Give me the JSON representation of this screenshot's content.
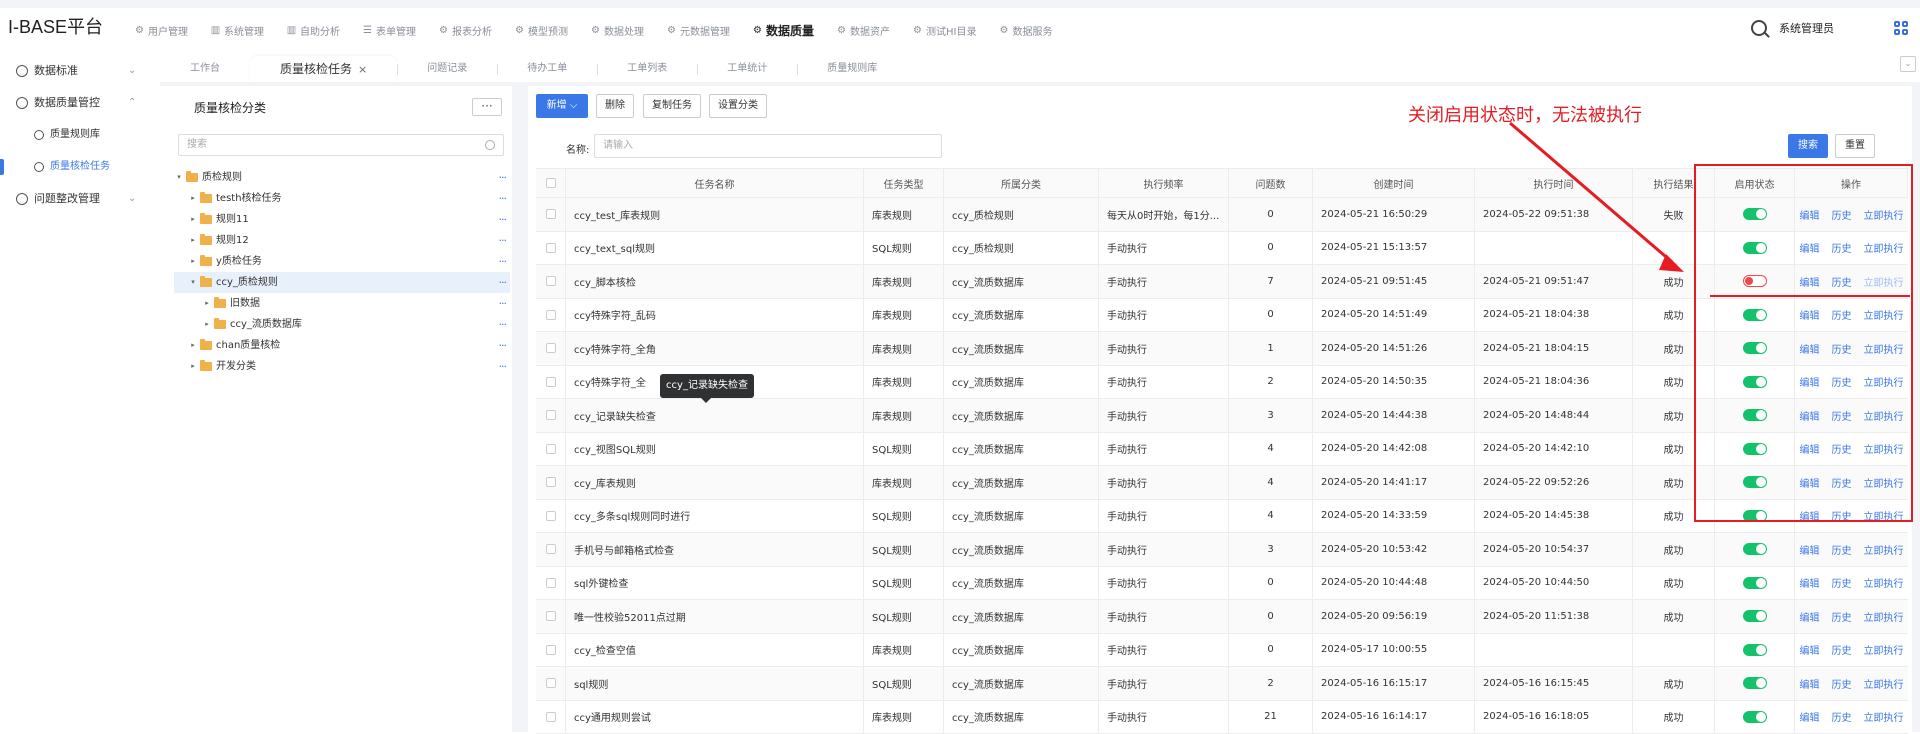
{
  "app": {
    "title": "I-BASE平台",
    "user": "系统管理员"
  },
  "topnav": [
    {
      "label": "用户管理",
      "icon": "gear-icon",
      "glyph": "⚙"
    },
    {
      "label": "系统管理",
      "icon": "bar-chart-icon",
      "glyph": "▥"
    },
    {
      "label": "自助分析",
      "icon": "bar-chart-icon",
      "glyph": "▥"
    },
    {
      "label": "表单管理",
      "icon": "list-icon",
      "glyph": "☰"
    },
    {
      "label": "报表分析",
      "icon": "gear-icon",
      "glyph": "⚙"
    },
    {
      "label": "模型预测",
      "icon": "gear-icon",
      "glyph": "⚙"
    },
    {
      "label": "数据处理",
      "icon": "gear-icon",
      "glyph": "⚙"
    },
    {
      "label": "元数据管理",
      "icon": "gear-icon",
      "glyph": "⚙"
    },
    {
      "label": "数据质量",
      "icon": "gear-icon",
      "glyph": "⚙",
      "active": true
    },
    {
      "label": "数据资产",
      "icon": "gear-icon",
      "glyph": "⚙"
    },
    {
      "label": "测试HI目录",
      "icon": "gear-icon",
      "glyph": "⚙"
    },
    {
      "label": "数据服务",
      "icon": "gear-icon",
      "glyph": "⚙"
    }
  ],
  "sidebar": {
    "items": [
      {
        "label": "数据标准",
        "arrow": "⌄"
      },
      {
        "label": "数据质量管控",
        "arrow": "⌃"
      },
      {
        "label": "质量规则库",
        "sub": true
      },
      {
        "label": "质量核检任务",
        "sub": true,
        "active": true
      },
      {
        "label": "问题整改管理",
        "arrow": "⌄"
      }
    ]
  },
  "tabs": [
    {
      "label": "工作台"
    },
    {
      "label": "质量核检任务",
      "active": true,
      "close": "×"
    },
    {
      "label": "问题记录"
    },
    {
      "label": "待办工单"
    },
    {
      "label": "工单列表"
    },
    {
      "label": "工单统计"
    },
    {
      "label": "质量规则库"
    }
  ],
  "tree": {
    "title": "质量核检分类",
    "more": "···",
    "search_placeholder": "搜索",
    "nodes": [
      {
        "label": "质检规则",
        "depth": 0,
        "tw": "▾",
        "selected": false
      },
      {
        "label": "testh核检任务",
        "depth": 1,
        "tw": "▸",
        "selected": false
      },
      {
        "label": "规则11",
        "depth": 1,
        "tw": "▸",
        "selected": false
      },
      {
        "label": "规则12",
        "depth": 1,
        "tw": "▸",
        "selected": false
      },
      {
        "label": "y质检任务",
        "depth": 1,
        "tw": "▸",
        "selected": false
      },
      {
        "label": "ccy_质检规则",
        "depth": 1,
        "tw": "▾",
        "selected": true
      },
      {
        "label": "旧数据",
        "depth": 2,
        "tw": "▸",
        "selected": false
      },
      {
        "label": "ccy_流质数据库",
        "depth": 2,
        "tw": "▸",
        "selected": false
      },
      {
        "label": "chan质量核检",
        "depth": 1,
        "tw": "▸",
        "selected": false
      },
      {
        "label": "开发分类",
        "depth": 1,
        "tw": "▸",
        "selected": false
      }
    ],
    "node_dots": "···"
  },
  "toolbar": {
    "new": "新增 ⌵",
    "delete": "删除",
    "copy": "复制任务",
    "category": "设置分类",
    "search": "搜索",
    "reset": "重置"
  },
  "filter": {
    "label": "名称:",
    "placeholder": "请输入"
  },
  "table": {
    "headers": [
      "任务名称",
      "任务类型",
      "所属分类",
      "执行频率",
      "问题数",
      "创建时间",
      "执行时间",
      "执行结果",
      "启用状态",
      "操作"
    ],
    "ops": [
      "编辑",
      "历史",
      "立即执行"
    ],
    "rows": [
      {
        "name": "ccy_test_库表规则",
        "type": "库表规则",
        "cat": "ccy_质检规则",
        "freq": "每天从0时开始，每1分...",
        "issues": "0",
        "created": "2024-05-21 16:50:29",
        "executed": "2024-05-22 09:51:38",
        "result": "失败",
        "enabled": true
      },
      {
        "name": "ccy_text_sql规则",
        "type": "SQL规则",
        "cat": "ccy_质检规则",
        "freq": "手动执行",
        "issues": "0",
        "created": "2024-05-21 15:13:57",
        "executed": "",
        "result": "",
        "enabled": true
      },
      {
        "name": "ccy_脚本核检",
        "type": "库表规则",
        "cat": "ccy_流质数据库",
        "freq": "手动执行",
        "issues": "7",
        "created": "2024-05-21 09:51:45",
        "executed": "2024-05-21 09:51:47",
        "result": "成功",
        "enabled": false
      },
      {
        "name": "ccy特殊字符_乱码",
        "type": "库表规则",
        "cat": "ccy_流质数据库",
        "freq": "手动执行",
        "issues": "0",
        "created": "2024-05-20 14:51:49",
        "executed": "2024-05-21 18:04:38",
        "result": "成功",
        "enabled": true
      },
      {
        "name": "ccy特殊字符_全角",
        "type": "库表规则",
        "cat": "ccy_流质数据库",
        "freq": "手动执行",
        "issues": "1",
        "created": "2024-05-20 14:51:26",
        "executed": "2024-05-21 18:04:15",
        "result": "成功",
        "enabled": true
      },
      {
        "name": "ccy特殊字符_全",
        "type": "库表规则",
        "cat": "ccy_流质数据库",
        "freq": "手动执行",
        "issues": "2",
        "created": "2024-05-20 14:50:35",
        "executed": "2024-05-21 18:04:36",
        "result": "成功",
        "enabled": true
      },
      {
        "name": "ccy_记录缺失检查",
        "type": "库表规则",
        "cat": "ccy_流质数据库",
        "freq": "手动执行",
        "issues": "3",
        "created": "2024-05-20 14:44:38",
        "executed": "2024-05-20 14:48:44",
        "result": "成功",
        "enabled": true
      },
      {
        "name": "ccy_视图SQL规则",
        "type": "SQL规则",
        "cat": "ccy_流质数据库",
        "freq": "手动执行",
        "issues": "4",
        "created": "2024-05-20 14:42:08",
        "executed": "2024-05-20 14:42:10",
        "result": "成功",
        "enabled": true
      },
      {
        "name": "ccy_库表规则",
        "type": "库表规则",
        "cat": "ccy_流质数据库",
        "freq": "手动执行",
        "issues": "4",
        "created": "2024-05-20 14:41:17",
        "executed": "2024-05-22 09:52:26",
        "result": "成功",
        "enabled": true
      },
      {
        "name": "ccy_多条sql规则同时进行",
        "type": "SQL规则",
        "cat": "ccy_流质数据库",
        "freq": "手动执行",
        "issues": "4",
        "created": "2024-05-20 14:33:59",
        "executed": "2024-05-20 14:45:38",
        "result": "成功",
        "enabled": true
      },
      {
        "name": "手机号与邮箱格式检查",
        "type": "SQL规则",
        "cat": "ccy_流质数据库",
        "freq": "手动执行",
        "issues": "3",
        "created": "2024-05-20 10:53:42",
        "executed": "2024-05-20 10:54:37",
        "result": "成功",
        "enabled": true
      },
      {
        "name": "sql外键检查",
        "type": "SQL规则",
        "cat": "ccy_流质数据库",
        "freq": "手动执行",
        "issues": "0",
        "created": "2024-05-20 10:44:48",
        "executed": "2024-05-20 10:44:50",
        "result": "成功",
        "enabled": true
      },
      {
        "name": "唯一性校验52011点过期",
        "type": "SQL规则",
        "cat": "ccy_流质数据库",
        "freq": "手动执行",
        "issues": "0",
        "created": "2024-05-20 09:56:19",
        "executed": "2024-05-20 11:51:38",
        "result": "成功",
        "enabled": true
      },
      {
        "name": "ccy_检查空值",
        "type": "库表规则",
        "cat": "ccy_流质数据库",
        "freq": "手动执行",
        "issues": "0",
        "created": "2024-05-17 10:00:55",
        "executed": "",
        "result": "",
        "enabled": true
      },
      {
        "name": "sql规则",
        "type": "SQL规则",
        "cat": "ccy_流质数据库",
        "freq": "手动执行",
        "issues": "2",
        "created": "2024-05-16 16:15:17",
        "executed": "2024-05-16 16:15:45",
        "result": "成功",
        "enabled": true
      },
      {
        "name": "ccy通用规则尝试",
        "type": "库表规则",
        "cat": "ccy_流质数据库",
        "freq": "手动执行",
        "issues": "21",
        "created": "2024-05-16 16:14:17",
        "executed": "2024-05-16 16:18:05",
        "result": "成功",
        "enabled": true
      }
    ]
  },
  "tooltip": "ccy_记录缺失检查",
  "annotation": {
    "text": "关闭启用状态时，无法被执行",
    "color": "#e51c23"
  },
  "colors": {
    "accent": "#3b78e7",
    "success": "#13c26b",
    "danger": "#f04848"
  }
}
